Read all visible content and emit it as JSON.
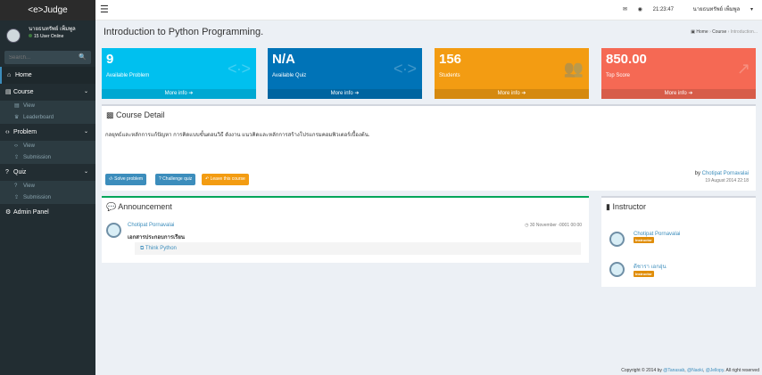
{
  "app": {
    "logo": "<e>Judge"
  },
  "user": {
    "name": "นายธนทรัพย์ เพ็มพูล",
    "status": "15 User Online"
  },
  "search": {
    "placeholder": "Search...",
    "icon": "🔍"
  },
  "sidebar": {
    "home": "Home",
    "course": "Course",
    "course_view": "View",
    "leaderboard": "Leaderboard",
    "problem": "Problem",
    "problem_view": "View",
    "problem_submission": "Submission",
    "quiz": "Quiz",
    "quiz_view": "View",
    "quiz_submission": "Submission",
    "admin": "Admin Panel"
  },
  "header": {
    "time": "21:23:47",
    "user": "นายธนทรัพย์ เพ็มพูล"
  },
  "page": {
    "title": "Introduction to Python Programming.",
    "breadcrumb": {
      "home": "Home",
      "course": "Course",
      "current": "Introduction..."
    }
  },
  "stats": [
    {
      "value": "9",
      "label": "Available Problem",
      "more": "More info",
      "color": "#00c0ef",
      "icon": "<∙>"
    },
    {
      "value": "N/A",
      "label": "Available Quiz",
      "more": "More info",
      "color": "#0073b7",
      "icon": "<∙>"
    },
    {
      "value": "156",
      "label": "Students",
      "more": "More info",
      "color": "#f39c12",
      "icon": "👥"
    },
    {
      "value": "850.00",
      "label": "Top Score",
      "more": "More info",
      "color": "#f56954",
      "icon": "↗"
    }
  ],
  "detail": {
    "heading": "Course Detail",
    "description": "กลยุทธ์และหลักการแก้ปัญหา การคิดแบบขั้นตอนวิธี ดังงาน แนวคิดและหลักการสร้างโปรแกรมคอมพิวเตอร์เบื้องต้น.",
    "by": "by",
    "author": "Chotipat Pornavalai",
    "date": "19 August 2014 22:18",
    "btn_solve": "Solve problem",
    "btn_quiz": "Challenge quiz",
    "btn_leave": "Leave this course"
  },
  "announcement": {
    "heading": "Announcement",
    "author": "Chotipat Pornavalai",
    "time": "30 November -0001 00:00",
    "title": "เอกสารประกอบการเรียน",
    "link": "Think Python"
  },
  "instructor": {
    "heading": "Instructor",
    "items": [
      {
        "name": "Chotipat Pornavalai",
        "role": "Instructor"
      },
      {
        "name": "ดีชารา เอกอุ่น",
        "role": "Instructor"
      }
    ]
  },
  "footer": {
    "prefix": "Copyright © 2014 by",
    "a1": "@Tanasab",
    "a2": "@Naoki",
    "a3": "@Jellopy",
    "suffix": ". All right reserved"
  }
}
